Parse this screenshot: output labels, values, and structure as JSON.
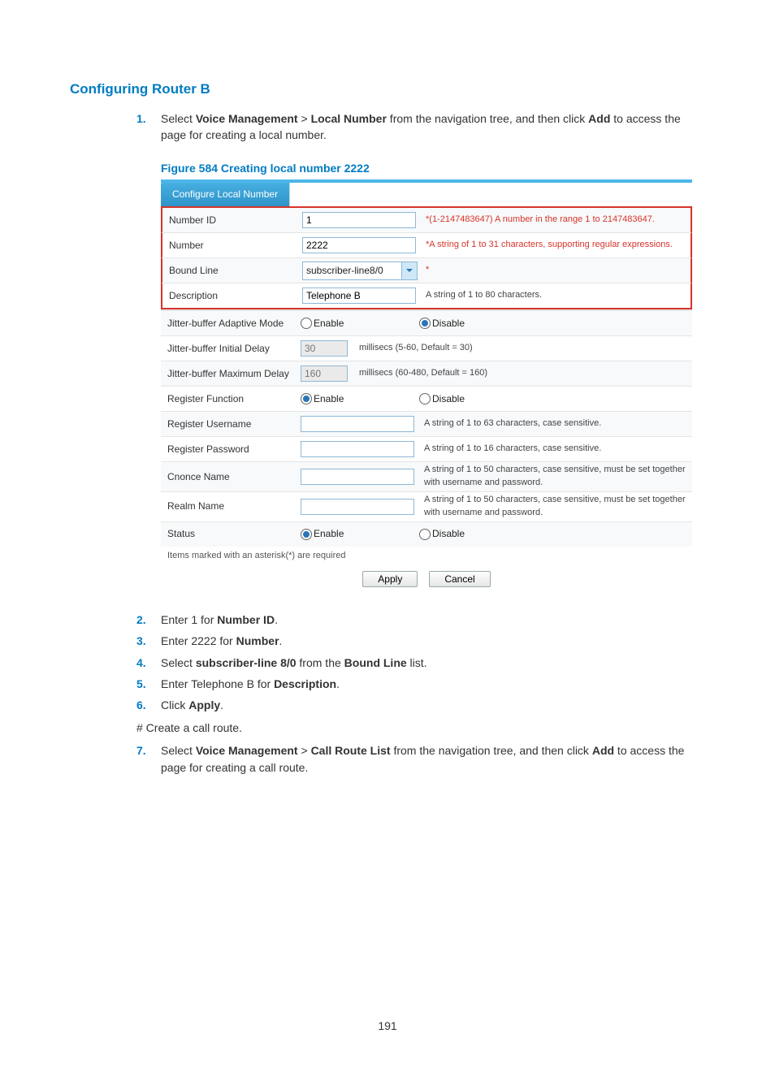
{
  "pageNumber": "191",
  "sectionTitle": "Configuring Router B",
  "figureCaption": "Figure 584 Creating local number 2222",
  "tabLabel": "Configure Local Number",
  "step1": {
    "prefix": "Select ",
    "b1": "Voice Management",
    "mid1": " > ",
    "b2": "Local Number",
    "mid2": " from the navigation tree, and then click ",
    "b3": "Add",
    "suffix": " to access the page for creating a local number."
  },
  "step2": {
    "prefix": "Enter 1 for ",
    "b": "Number ID",
    "suffix": "."
  },
  "step3": {
    "prefix": "Enter 2222 for ",
    "b": "Number",
    "suffix": "."
  },
  "step4": {
    "prefix": "Select ",
    "b1": "subscriber-line 8/0",
    "mid": " from the ",
    "b2": "Bound Line",
    "suffix": " list."
  },
  "step5": {
    "prefix": "Enter Telephone B for ",
    "b": "Description",
    "suffix": "."
  },
  "step6": {
    "prefix": "Click ",
    "b": "Apply",
    "suffix": "."
  },
  "hashNote": "# Create a call route.",
  "step7": {
    "prefix": "Select ",
    "b1": "Voice Management",
    "mid1": " > ",
    "b2": "Call Route List",
    "mid2": " from the navigation tree, and then click ",
    "b3": "Add",
    "suffix": " to access the page for creating a call route."
  },
  "form": {
    "numberId": {
      "label": "Number ID",
      "value": "1",
      "help": "*(1-2147483647) A number in the range 1 to 2147483647."
    },
    "number": {
      "label": "Number",
      "value": "2222",
      "help": "*A string of 1 to 31 characters, supporting regular expressions."
    },
    "boundLine": {
      "label": "Bound Line",
      "value": "subscriber-line8/0",
      "help": "*"
    },
    "description": {
      "label": "Description",
      "value": "Telephone B",
      "help": "A string of 1 to 80 characters."
    },
    "jitterAdaptive": {
      "label": "Jitter-buffer Adaptive Mode",
      "enable": "Enable",
      "disable": "Disable",
      "selected": "disable"
    },
    "jitterInitial": {
      "label": "Jitter-buffer Initial Delay",
      "value": "30",
      "unit": "millisecs (5-60, Default = 30)"
    },
    "jitterMax": {
      "label": "Jitter-buffer Maximum Delay",
      "value": "160",
      "unit": "millisecs (60-480, Default = 160)"
    },
    "registerFunction": {
      "label": "Register Function",
      "enable": "Enable",
      "disable": "Disable",
      "selected": "enable"
    },
    "registerUsername": {
      "label": "Register Username",
      "value": "",
      "help": "A string of 1 to 63 characters, case sensitive."
    },
    "registerPassword": {
      "label": "Register Password",
      "value": "",
      "help": "A string of 1 to 16 characters, case sensitive."
    },
    "cnonceName": {
      "label": "Cnonce Name",
      "value": "",
      "help": "A string of 1 to 50 characters, case sensitive, must be set together with username and password."
    },
    "realmName": {
      "label": "Realm Name",
      "value": "",
      "help": "A string of 1 to 50 characters, case sensitive, must be set together with username and password."
    },
    "status": {
      "label": "Status",
      "enable": "Enable",
      "disable": "Disable",
      "selected": "enable"
    },
    "note": "Items marked with an asterisk(*) are required",
    "applyBtn": "Apply",
    "cancelBtn": "Cancel"
  }
}
